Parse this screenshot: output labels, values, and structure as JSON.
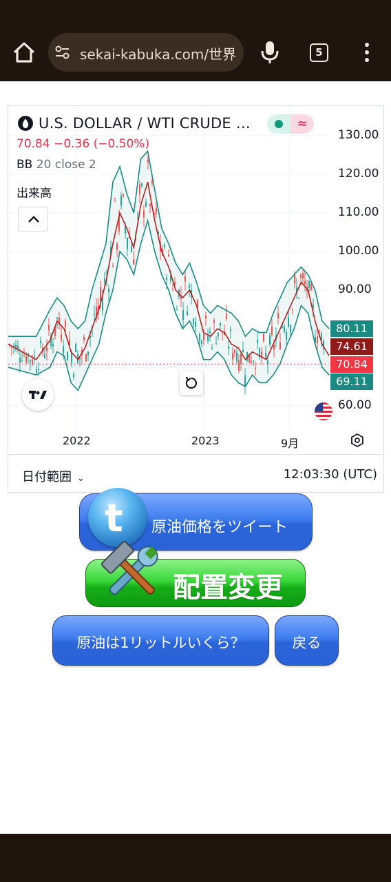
{
  "browser": {
    "url": "sekai-kabuka.com/世界",
    "tab_count": "5"
  },
  "chart_header": {
    "symbol_title": "U.S. DOLLAR / WTI CRUDE …",
    "price_line": "70.84 −0.36 (−0.50%)",
    "indicator_name": "BB",
    "indicator_params": "20 close 2",
    "volume_label": "出来高"
  },
  "chart_data": {
    "type": "line",
    "title": "U.S. DOLLAR / WTI CRUDE …",
    "x_tick_labels": [
      "2022",
      "2023",
      "9月"
    ],
    "y_tick_labels": [
      "130.00",
      "120.00",
      "110.00",
      "100.00",
      "90.00",
      "60.00"
    ],
    "ylim": [
      55,
      132
    ],
    "price_tags": [
      {
        "value": "80.11",
        "color": "#1a8a82"
      },
      {
        "value": "74.61",
        "color": "#8e1a1a"
      },
      {
        "value": "70.84",
        "color": "#f23645"
      },
      {
        "value": "69.11",
        "color": "#1a8a82"
      }
    ],
    "series": [
      {
        "name": "BB basis",
        "color": "#b22222",
        "x": [
          0,
          20,
          40,
          60,
          70,
          80,
          90,
          100,
          110,
          120,
          130,
          140,
          150,
          160,
          170,
          180,
          190,
          200,
          210,
          220,
          230,
          240,
          250,
          260,
          270,
          280,
          290,
          300,
          310,
          320,
          330,
          340,
          350,
          360,
          370,
          380,
          390,
          400,
          410,
          420,
          430,
          440,
          450,
          460
        ],
        "values": [
          76,
          74,
          72,
          77,
          82,
          80,
          74,
          72,
          75,
          80,
          85,
          92,
          102,
          110,
          106,
          101,
          112,
          118,
          108,
          100,
          96,
          90,
          88,
          90,
          86,
          79,
          78,
          80,
          79,
          76,
          75,
          72,
          74,
          73,
          72,
          76,
          80,
          84,
          88,
          92,
          90,
          82,
          76,
          73
        ]
      },
      {
        "name": "BB upper",
        "color": "#1a8a82",
        "x": [
          0,
          20,
          40,
          60,
          70,
          80,
          90,
          100,
          110,
          120,
          130,
          140,
          150,
          160,
          170,
          180,
          190,
          200,
          210,
          220,
          230,
          240,
          250,
          260,
          270,
          280,
          290,
          300,
          310,
          320,
          330,
          340,
          350,
          360,
          370,
          380,
          390,
          400,
          410,
          420,
          430,
          440,
          450,
          460
        ],
        "values": [
          78,
          78,
          78,
          85,
          88,
          86,
          82,
          80,
          82,
          90,
          96,
          102,
          118,
          122,
          115,
          110,
          124,
          126,
          116,
          106,
          102,
          97,
          94,
          97,
          92,
          86,
          84,
          86,
          85,
          84,
          82,
          78,
          80,
          79,
          79,
          84,
          88,
          92,
          94,
          96,
          94,
          90,
          82,
          80
        ]
      },
      {
        "name": "BB lower",
        "color": "#1a8a82",
        "x": [
          0,
          20,
          40,
          60,
          70,
          80,
          90,
          100,
          110,
          120,
          130,
          140,
          150,
          160,
          170,
          180,
          190,
          200,
          210,
          220,
          230,
          240,
          250,
          260,
          270,
          280,
          290,
          300,
          310,
          320,
          330,
          340,
          350,
          360,
          370,
          380,
          390,
          400,
          410,
          420,
          430,
          440,
          450,
          460
        ],
        "values": [
          70,
          69,
          68,
          70,
          74,
          73,
          66,
          64,
          68,
          72,
          76,
          84,
          90,
          100,
          98,
          94,
          102,
          108,
          100,
          94,
          90,
          84,
          80,
          82,
          78,
          72,
          72,
          74,
          72,
          68,
          66,
          65,
          68,
          66,
          66,
          68,
          71,
          76,
          80,
          86,
          84,
          76,
          70,
          68
        ]
      }
    ],
    "reference_lines": [
      {
        "value": 70.84,
        "style": "dotted",
        "color": "#f23645"
      }
    ],
    "grid": true
  },
  "chart_footer": {
    "range_label": "日付範囲",
    "clock": "12:03:30 (UTC)"
  },
  "buttons": {
    "tweet": "原油価格をツイート",
    "layout": "配置変更",
    "liter": "原油は1リットルいくら？",
    "back": "戻る"
  }
}
